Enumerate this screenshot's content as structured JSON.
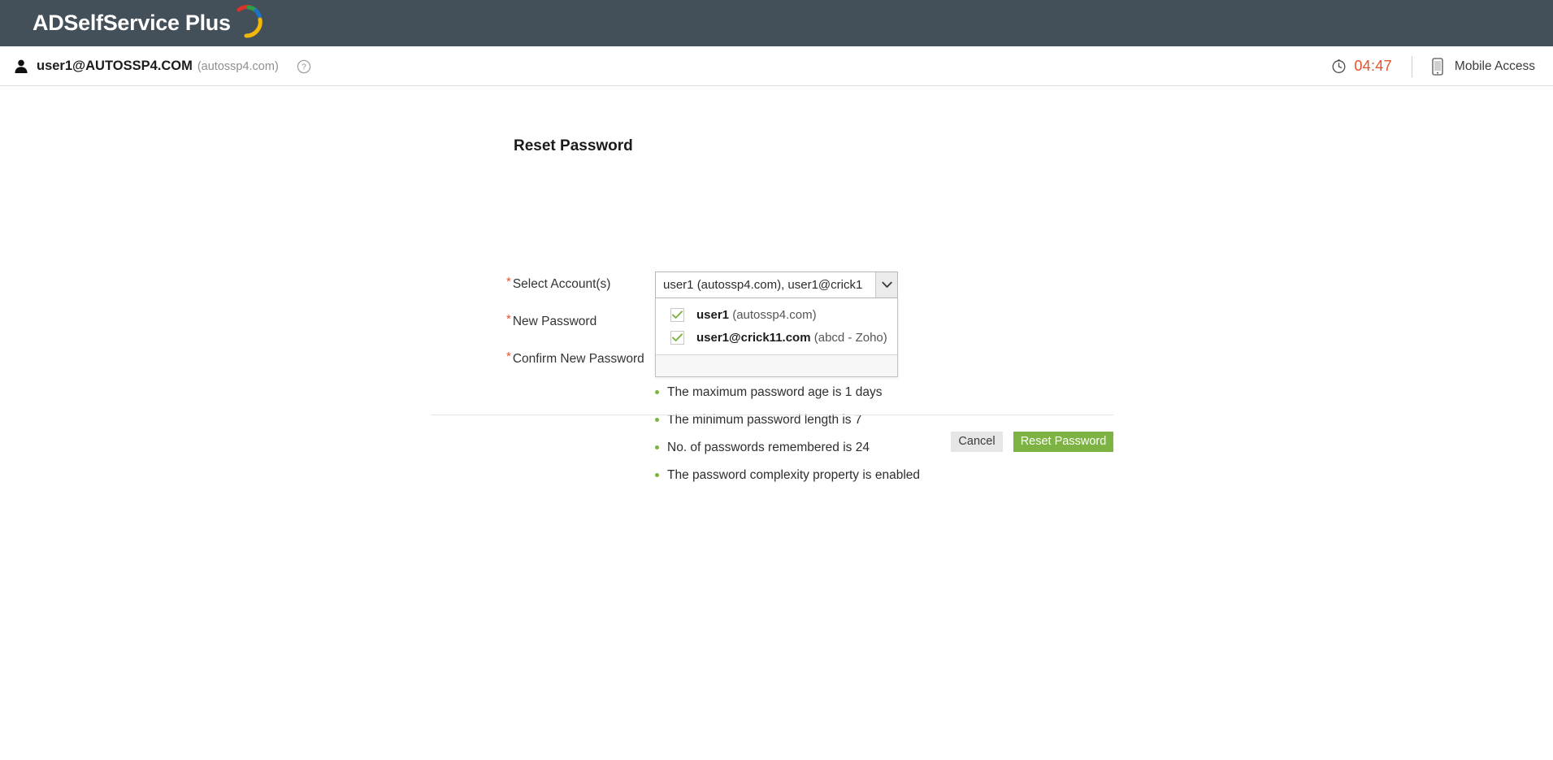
{
  "header": {
    "product_name": "ADSelfService Plus",
    "logo_icon": "adselfservice-arc-logo"
  },
  "user_bar": {
    "user_icon": "user-silhouette-icon",
    "username": "user1@AUTOSSP4.COM",
    "domain": "(autossp4.com)",
    "help_icon": "help-circle-icon",
    "clock_icon": "clock-icon",
    "session_timer": "04:47",
    "mobile_icon": "mobile-phone-icon",
    "mobile_label": "Mobile Access",
    "timer_color": "#e8502a"
  },
  "page": {
    "title": "Reset Password"
  },
  "form": {
    "required_marker": "*",
    "labels": {
      "select_accounts": "Select Account(s)",
      "new_password": "New Password",
      "confirm_new_password": "Confirm New Password"
    },
    "new_password_value": "",
    "new_password_placeholder": "",
    "confirm_password_value": "",
    "confirm_password_placeholder": ""
  },
  "account_select": {
    "display_value": "user1 (autossp4.com), user1@crick1",
    "arrow_icon": "chevron-down-icon",
    "expanded": true,
    "options": [
      {
        "name": "user1",
        "detail": "(autossp4.com)",
        "checked": true,
        "check_icon": "checkmark-icon"
      },
      {
        "name": "user1@crick11.com",
        "detail": "(abcd - Zoho)",
        "checked": true,
        "check_icon": "checkmark-icon"
      }
    ]
  },
  "password_policy": {
    "bullet_color": "#7cb342",
    "rules": [
      "The maximum password age is 1 days",
      "The minimum password length is 7",
      "No. of passwords remembered is 24",
      "The password complexity property is enabled"
    ]
  },
  "actions": {
    "cancel_label": "Cancel",
    "submit_label": "Reset Password",
    "submit_color": "#7cb342",
    "cancel_color": "#e6e6e6"
  }
}
